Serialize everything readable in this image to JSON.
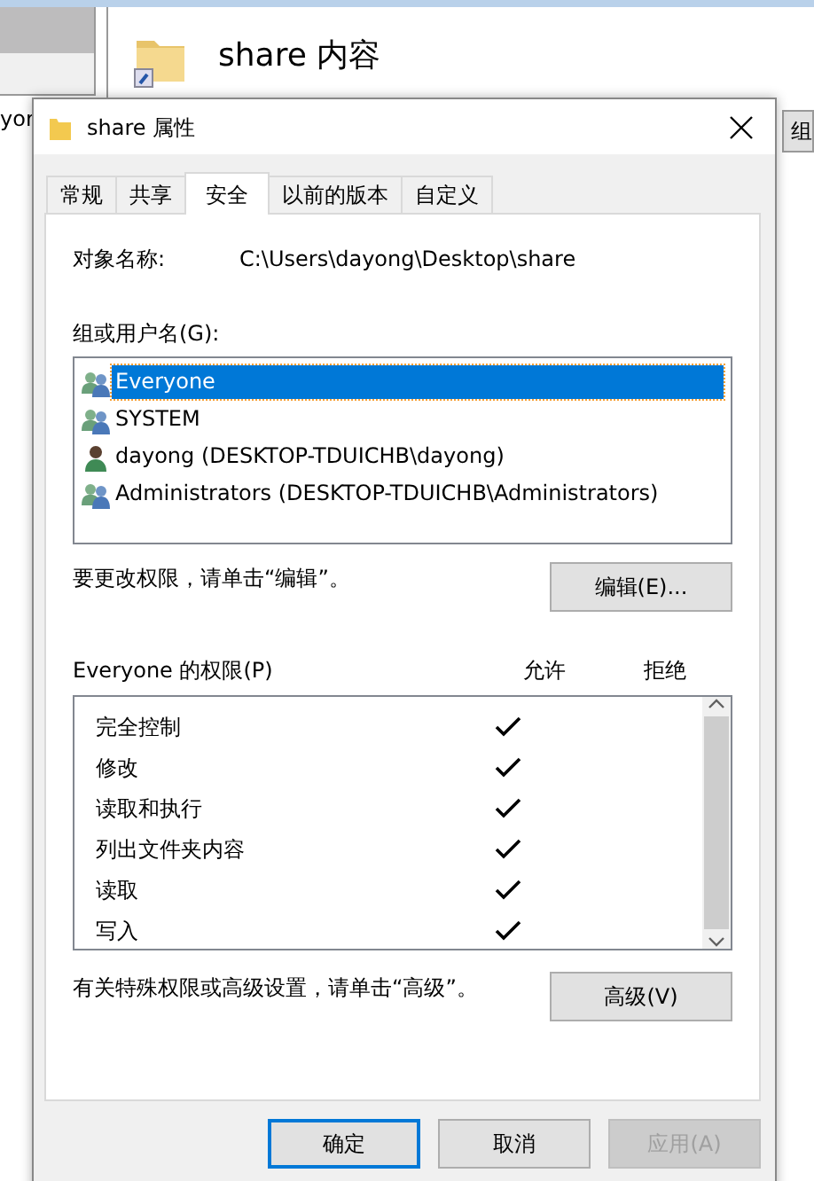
{
  "background_window": {
    "title": "share 内容",
    "left_fragment": "yor",
    "right_fragment": "组"
  },
  "dialog": {
    "title": "share 属性"
  },
  "tabs": [
    {
      "label": "常规",
      "selected": false
    },
    {
      "label": "共享",
      "selected": false
    },
    {
      "label": "安全",
      "selected": true
    },
    {
      "label": "以前的版本",
      "selected": false
    },
    {
      "label": "自定义",
      "selected": false
    }
  ],
  "object_name": {
    "label": "对象名称:",
    "value": "C:\\Users\\dayong\\Desktop\\share"
  },
  "users_label": "组或用户名(G):",
  "users": [
    {
      "name": "Everyone",
      "kind": "group",
      "selected": true
    },
    {
      "name": "SYSTEM",
      "kind": "group",
      "selected": false
    },
    {
      "name": "dayong (DESKTOP-TDUICHB\\dayong)",
      "kind": "user",
      "selected": false
    },
    {
      "name": "Administrators (DESKTOP-TDUICHB\\Administrators)",
      "kind": "group",
      "selected": false
    }
  ],
  "edit_hint": "要更改权限，请单击“编辑”。",
  "edit_button": "编辑(E)...",
  "permissions_header": {
    "label": "Everyone 的权限(P)",
    "allow": "允许",
    "deny": "拒绝"
  },
  "permissions": [
    {
      "name": "完全控制",
      "allow": true,
      "deny": false
    },
    {
      "name": "修改",
      "allow": true,
      "deny": false
    },
    {
      "name": "读取和执行",
      "allow": true,
      "deny": false
    },
    {
      "name": "列出文件夹内容",
      "allow": true,
      "deny": false
    },
    {
      "name": "读取",
      "allow": true,
      "deny": false
    },
    {
      "name": "写入",
      "allow": true,
      "deny": false
    }
  ],
  "advanced_hint": "有关特殊权限或高级设置，请单击“高级”。",
  "advanced_button": "高级(V)",
  "buttons": [
    {
      "label": "确定",
      "default": true,
      "disabled": false
    },
    {
      "label": "取消",
      "default": false,
      "disabled": false
    },
    {
      "label": "应用(A)",
      "default": false,
      "disabled": true
    }
  ]
}
